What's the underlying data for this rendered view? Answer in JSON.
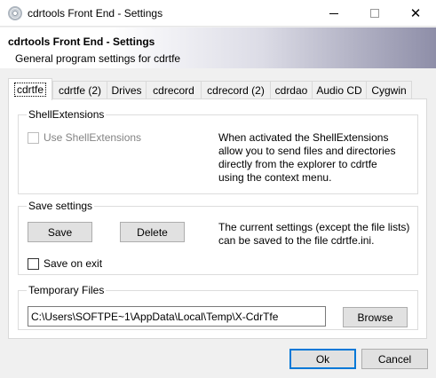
{
  "window": {
    "title": "cdrtools Front End - Settings",
    "close_glyph": "✕"
  },
  "header": {
    "title": "cdrtools Front End - Settings",
    "subtitle": "General program settings for cdrtfe"
  },
  "tabs": [
    {
      "label": "cdrtfe",
      "active": true
    },
    {
      "label": "cdrtfe (2)"
    },
    {
      "label": "Drives"
    },
    {
      "label": "cdrecord"
    },
    {
      "label": "cdrecord (2)"
    },
    {
      "label": "cdrdao"
    },
    {
      "label": "Audio CD"
    },
    {
      "label": "Cygwin"
    }
  ],
  "shell_extensions": {
    "group_label": "ShellExtensions",
    "checkbox_label": "Use ShellExtensions",
    "checked": false,
    "enabled": false,
    "description": [
      "When activated the ShellExtensions",
      "allow you to send files and directories",
      "directly from the explorer to cdrtfe",
      "using the context menu."
    ]
  },
  "save_settings": {
    "group_label": "Save settings",
    "save_button": "Save",
    "delete_button": "Delete",
    "description": [
      "The current settings (except the file lists)",
      "can be saved to the file cdrtfe.ini."
    ],
    "save_on_exit_label": "Save on exit",
    "save_on_exit_checked": false
  },
  "temp_files": {
    "group_label": "Temporary Files",
    "path_value": "C:\\Users\\SOFTPE~1\\AppData\\Local\\Temp\\X-CdrTfe",
    "browse_button": "Browse"
  },
  "footer": {
    "ok_button": "Ok",
    "cancel_button": "Cancel"
  }
}
